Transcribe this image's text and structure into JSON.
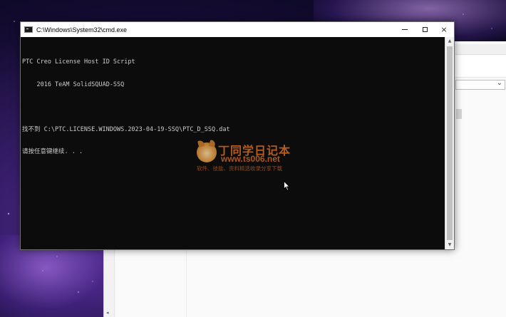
{
  "window": {
    "title": "C:\\Windows\\System32\\cmd.exe",
    "controls": {
      "minimize": "minimize",
      "maximize": "maximize",
      "close": "×"
    }
  },
  "console": {
    "lines": [
      "PTC Creo License Host ID Script",
      "    2016 TeAM SolidSQUAD-SSQ",
      "",
      "找不到 C:\\PTC.LICENSE.WINDOWS.2023-04-19-SSQ\\PTC_D_SSQ.dat",
      "请按任意键继续. . ."
    ]
  },
  "watermark": {
    "title": "丁同学日记本",
    "url": "www.ts006.net",
    "tagline": "软件、技能、资料精选收录分享下载"
  },
  "icons": {
    "cmd": "cmd-app-icon",
    "cursor": "mouse-pointer-icon",
    "scroll_up": "▲",
    "scroll_down": "▼",
    "dropdown": "⌄",
    "left_col_arrow": "◂"
  },
  "colors": {
    "console_bg": "#0c0c0c",
    "console_text": "#cccccc",
    "watermark": "#c8641f"
  }
}
